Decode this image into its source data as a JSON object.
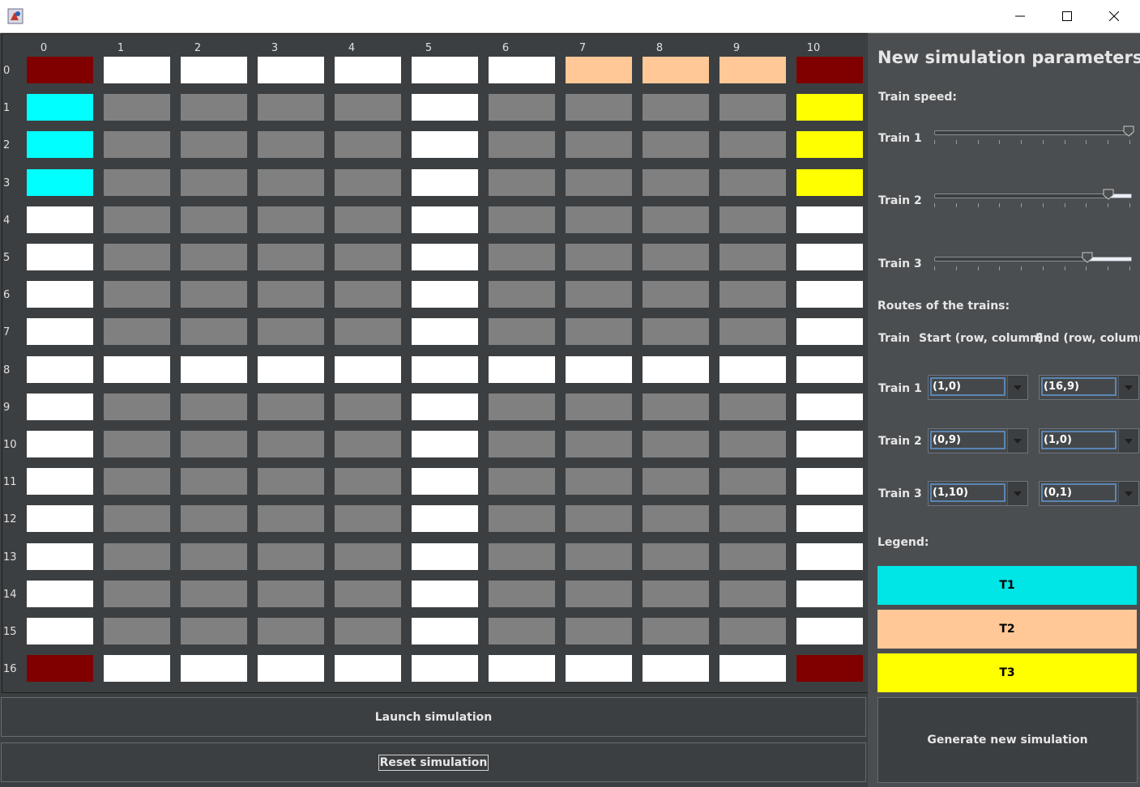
{
  "window": {
    "title": ""
  },
  "grid": {
    "columns": [
      "0",
      "1",
      "2",
      "3",
      "4",
      "5",
      "6",
      "7",
      "8",
      "9",
      "10"
    ],
    "rows": [
      "0",
      "1",
      "2",
      "3",
      "4",
      "5",
      "6",
      "7",
      "8",
      "9",
      "10",
      "11",
      "12",
      "13",
      "14",
      "15",
      "16"
    ],
    "cells": [
      [
        "station",
        "white",
        "white",
        "white",
        "white",
        "white",
        "white",
        "peach",
        "peach",
        "peach",
        "station"
      ],
      [
        "cyan",
        "grey",
        "grey",
        "grey",
        "grey",
        "white",
        "grey",
        "grey",
        "grey",
        "grey",
        "yellow"
      ],
      [
        "cyan",
        "grey",
        "grey",
        "grey",
        "grey",
        "white",
        "grey",
        "grey",
        "grey",
        "grey",
        "yellow"
      ],
      [
        "cyan",
        "grey",
        "grey",
        "grey",
        "grey",
        "white",
        "grey",
        "grey",
        "grey",
        "grey",
        "yellow"
      ],
      [
        "white",
        "grey",
        "grey",
        "grey",
        "grey",
        "white",
        "grey",
        "grey",
        "grey",
        "grey",
        "white"
      ],
      [
        "white",
        "grey",
        "grey",
        "grey",
        "grey",
        "white",
        "grey",
        "grey",
        "grey",
        "grey",
        "white"
      ],
      [
        "white",
        "grey",
        "grey",
        "grey",
        "grey",
        "white",
        "grey",
        "grey",
        "grey",
        "grey",
        "white"
      ],
      [
        "white",
        "grey",
        "grey",
        "grey",
        "grey",
        "white",
        "grey",
        "grey",
        "grey",
        "grey",
        "white"
      ],
      [
        "white",
        "white",
        "white",
        "white",
        "white",
        "white",
        "white",
        "white",
        "white",
        "white",
        "white"
      ],
      [
        "white",
        "grey",
        "grey",
        "grey",
        "grey",
        "white",
        "grey",
        "grey",
        "grey",
        "grey",
        "white"
      ],
      [
        "white",
        "grey",
        "grey",
        "grey",
        "grey",
        "white",
        "grey",
        "grey",
        "grey",
        "grey",
        "white"
      ],
      [
        "white",
        "grey",
        "grey",
        "grey",
        "grey",
        "white",
        "grey",
        "grey",
        "grey",
        "grey",
        "white"
      ],
      [
        "white",
        "grey",
        "grey",
        "grey",
        "grey",
        "white",
        "grey",
        "grey",
        "grey",
        "grey",
        "white"
      ],
      [
        "white",
        "grey",
        "grey",
        "grey",
        "grey",
        "white",
        "grey",
        "grey",
        "grey",
        "grey",
        "white"
      ],
      [
        "white",
        "grey",
        "grey",
        "grey",
        "grey",
        "white",
        "grey",
        "grey",
        "grey",
        "grey",
        "white"
      ],
      [
        "white",
        "grey",
        "grey",
        "grey",
        "grey",
        "white",
        "grey",
        "grey",
        "grey",
        "grey",
        "white"
      ],
      [
        "station",
        "white",
        "white",
        "white",
        "white",
        "white",
        "white",
        "white",
        "white",
        "white",
        "station"
      ]
    ],
    "colors": {
      "white": "#ffffff",
      "grey": "#808080",
      "station": "#800000",
      "cyan": "#00ffff",
      "peach": "#ffc896",
      "yellow": "#ffff00"
    }
  },
  "params": {
    "title": "New simulation parameters",
    "speed_label": "Train speed:",
    "trains": [
      {
        "label": "Train 1",
        "speed": 0.99
      },
      {
        "label": "Train 2",
        "speed": 0.89
      },
      {
        "label": "Train 3",
        "speed": 0.78
      }
    ],
    "routes_label": "Routes of the trains:",
    "routes_headers": {
      "train": "Train",
      "start": "Start (row, column)",
      "end": "End (row, column)"
    },
    "routes": [
      {
        "label": "Train 1",
        "start": "(1,0)",
        "end": "(16,9)"
      },
      {
        "label": "Train 2",
        "start": "(0,9)",
        "end": "(1,0)"
      },
      {
        "label": "Train 3",
        "start": "(1,10)",
        "end": "(0,1)"
      }
    ],
    "legend_label": "Legend:",
    "legend": [
      {
        "name": "T1",
        "color": "#00e5e5"
      },
      {
        "name": "T2",
        "color": "#ffc896"
      },
      {
        "name": "T3",
        "color": "#ffff00"
      }
    ]
  },
  "actions": {
    "launch": "Launch simulation",
    "reset": "Reset simulation",
    "generate": "Generate new simulation"
  }
}
